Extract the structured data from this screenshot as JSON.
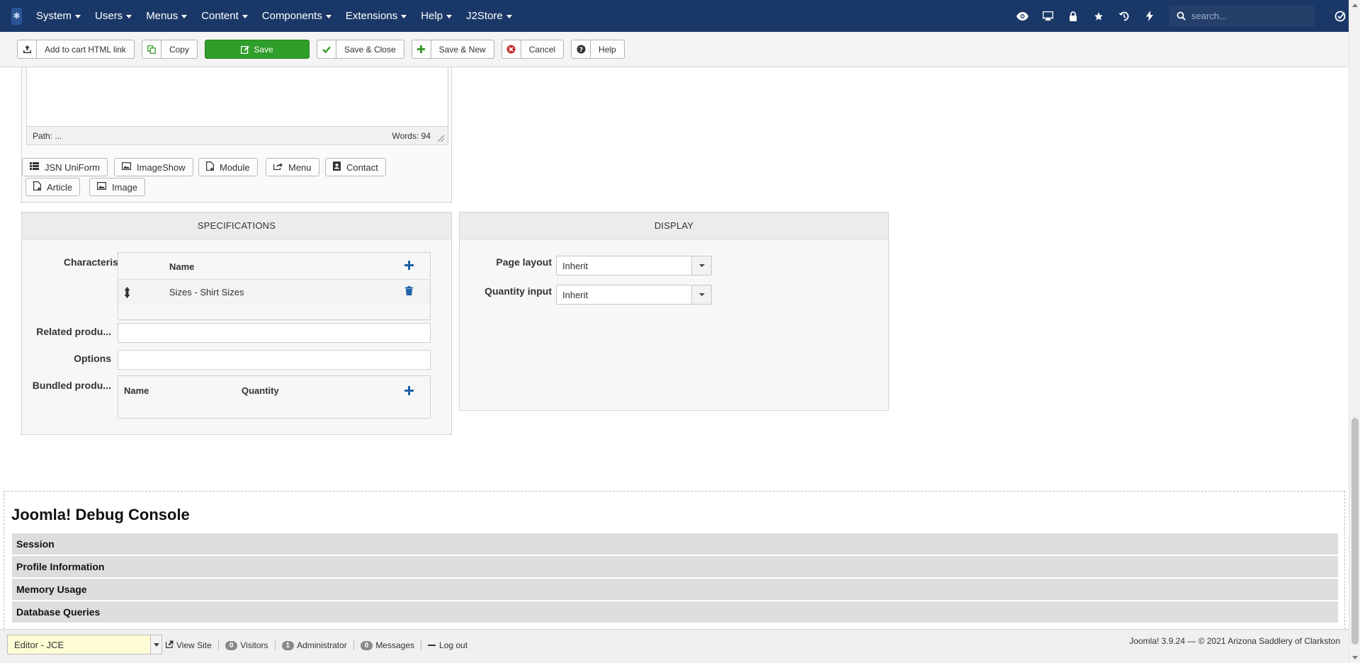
{
  "navbar": {
    "logo": "Joomla logo",
    "menu": [
      {
        "label": "System"
      },
      {
        "label": "Users"
      },
      {
        "label": "Menus"
      },
      {
        "label": "Content"
      },
      {
        "label": "Components"
      },
      {
        "label": "Extensions"
      },
      {
        "label": "Help"
      },
      {
        "label": "J2Store"
      }
    ],
    "search_placeholder": "search..."
  },
  "toolbar": {
    "add_to_cart_label": "Add to cart HTML link",
    "copy_label": "Copy",
    "save_label": "Save",
    "save_close_label": "Save & Close",
    "save_new_label": "Save & New",
    "cancel_label": "Cancel",
    "help_label": "Help",
    "save_color": "#2f9e2a"
  },
  "editor": {
    "path_label": "Path: ...",
    "words_label": "Words: 94",
    "buttons": {
      "jsn_uniform": "JSN UniForm",
      "imageshow": "ImageShow",
      "module": "Module",
      "menu": "Menu",
      "contact": "Contact",
      "article": "Article",
      "image": "Image"
    }
  },
  "specifications": {
    "title": "SPECIFICATIONS",
    "characteristics_label": "Characteristics",
    "characteristics_name_header": "Name",
    "characteristics_rows": [
      {
        "name": "Sizes - Shirt Sizes"
      }
    ],
    "related_products_label": "Related produ...",
    "options_label": "Options",
    "bundled_products_label": "Bundled produ...",
    "bundled_name_header": "Name",
    "bundled_quantity_header": "Quantity"
  },
  "display": {
    "title": "DISPLAY",
    "page_layout_label": "Page layout",
    "page_layout_value": "Inherit",
    "quantity_input_label": "Quantity input",
    "quantity_input_value": "Inherit"
  },
  "debug": {
    "title": "Joomla! Debug Console",
    "sections": [
      {
        "label": "Session"
      },
      {
        "label": "Profile Information"
      },
      {
        "label": "Memory Usage"
      },
      {
        "label": "Database Queries"
      }
    ]
  },
  "statusbar": {
    "editor_value": "Editor - JCE",
    "view_site_label": "View Site",
    "visitors_count": "0",
    "visitors_label": "Visitors",
    "admin_count": "1",
    "admin_label": "Administrator",
    "messages_count": "0",
    "messages_label": "Messages",
    "logout_label": "Log out",
    "copyright": "Joomla! 3.9.24  —  © 2021 Arizona Saddlery of Clarkston"
  }
}
